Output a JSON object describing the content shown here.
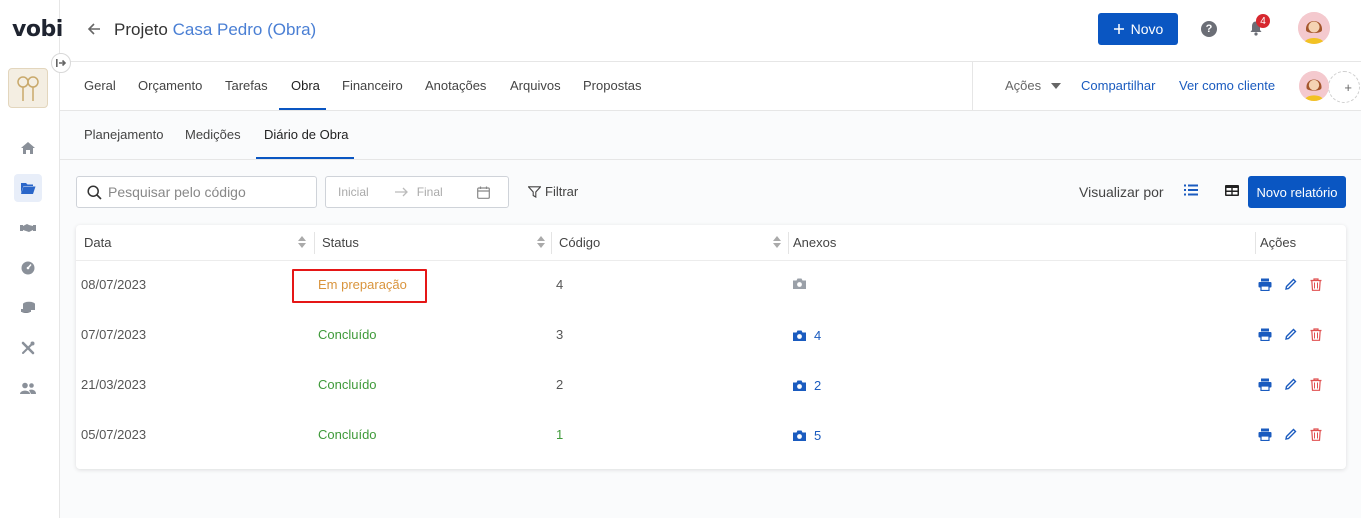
{
  "app": {
    "logo": "vobi"
  },
  "header": {
    "title_prefix": "Projeto",
    "project_name": "Casa Pedro (Obra)",
    "new_button": "Novo",
    "help": "?",
    "notifications_count": "4"
  },
  "tabs": {
    "items": [
      "Geral",
      "Orçamento",
      "Tarefas",
      "Obra",
      "Financeiro",
      "Anotações",
      "Arquivos",
      "Propostas"
    ],
    "active": "Obra",
    "acoes": "Ações",
    "share": "Compartilhar",
    "view_as_client": "Ver como cliente",
    "add_person": "+"
  },
  "subtabs": {
    "items": [
      "Planejamento",
      "Medições",
      "Diário de Obra"
    ],
    "active": "Diário de Obra"
  },
  "toolbar": {
    "search_placeholder": "Pesquisar pelo código",
    "date_start": "Inicial",
    "date_end": "Final",
    "filter": "Filtrar",
    "view_label": "Visualizar por",
    "new_report": "Novo relatório"
  },
  "table": {
    "headers": [
      "Data",
      "Status",
      "Código",
      "Anexos",
      "Ações"
    ],
    "rows": [
      {
        "date": "08/07/2023",
        "status": "Em preparação",
        "code": "4",
        "attachments": ""
      },
      {
        "date": "07/07/2023",
        "status": "Concluído",
        "code": "3",
        "attachments": "4"
      },
      {
        "date": "21/03/2023",
        "status": "Concluído",
        "code": "2",
        "attachments": "2"
      },
      {
        "date": "05/07/2023",
        "status": "Concluído",
        "code": "1",
        "attachments": "5"
      }
    ]
  },
  "colors": {
    "primary": "#0a56c2",
    "link": "#1a5bbf",
    "status_preparing": "#d9943c",
    "status_done": "#3f9a3a",
    "delete": "#e05050",
    "highlight": "#e51616"
  }
}
